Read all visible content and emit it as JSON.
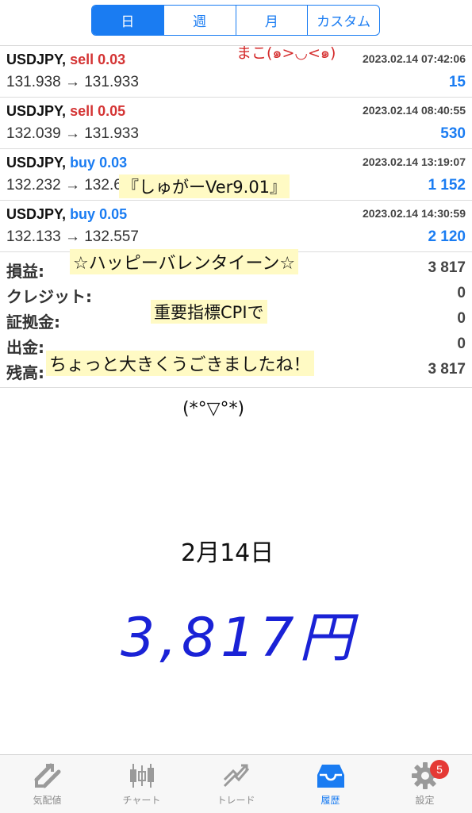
{
  "period_tabs": [
    "日",
    "週",
    "月",
    "カスタム"
  ],
  "trades": [
    {
      "symbol": "USDJPY,",
      "side": "sell",
      "volume": "0.03",
      "time": "2023.02.14 07:42:06",
      "prices": "131.938 → 131.933",
      "profit": "15"
    },
    {
      "symbol": "USDJPY,",
      "side": "sell",
      "volume": "0.05",
      "time": "2023.02.14 08:40:55",
      "prices": "132.039 → 131.933",
      "profit": "530"
    },
    {
      "symbol": "USDJPY,",
      "side": "buy",
      "volume": "0.03",
      "time": "2023.02.14 13:19:07",
      "prices": "132.232 → 132.616",
      "profit": "1 152"
    },
    {
      "symbol": "USDJPY,",
      "side": "buy",
      "volume": "0.05",
      "time": "2023.02.14 14:30:59",
      "prices": "132.133 → 132.557",
      "profit": "2 120"
    }
  ],
  "summary": [
    {
      "label": "損益:",
      "value": "3 817"
    },
    {
      "label": "クレジット:",
      "value": "0"
    },
    {
      "label": "証拠金:",
      "value": "0"
    },
    {
      "label": "出金:",
      "value": "0"
    },
    {
      "label": "残高:",
      "value": "3 817"
    }
  ],
  "annotations": {
    "author": "まこ(๑>◡<๑)",
    "ea_name": "『しゅがーVer9.01』",
    "valentine": "☆ハッピーバレンタイーン☆",
    "indicator": "重要指標CPIで",
    "moved": "ちょっと大きくうごきましたね！",
    "face": "(*°▽°*)",
    "date": "2月14日",
    "total": "3,817円"
  },
  "bottom_tabs": [
    {
      "label": "気配値",
      "icon": "quotes-icon"
    },
    {
      "label": "チャート",
      "icon": "chart-icon"
    },
    {
      "label": "トレード",
      "icon": "trade-icon"
    },
    {
      "label": "履歴",
      "icon": "history-icon"
    },
    {
      "label": "設定",
      "icon": "settings-icon",
      "badge": "5"
    }
  ],
  "colors": {
    "accent": "#1a7cf2",
    "sell": "#d43434",
    "handwriting_red": "#d42a2a",
    "handwriting_blue": "#1a22d6"
  }
}
